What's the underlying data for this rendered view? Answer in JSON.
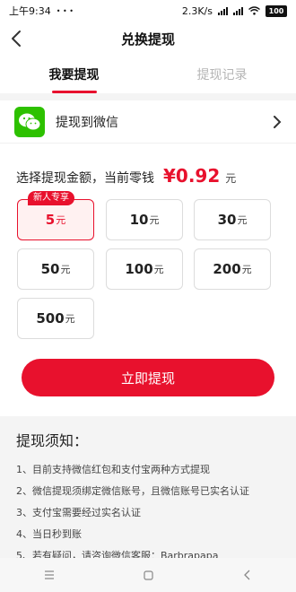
{
  "status": {
    "time": "上午9:34",
    "dots": "• • •",
    "net_speed": "2.3K/s",
    "battery": "100"
  },
  "header": {
    "title": "兑换提现"
  },
  "tabs": [
    {
      "label": "我要提现"
    },
    {
      "label": "提现记录"
    }
  ],
  "channel": {
    "label": "提现到微信"
  },
  "amount": {
    "prompt": "选择提现金额，当前零钱",
    "balance": "¥0.92",
    "unit": "元"
  },
  "badge": "新人专享",
  "options": [
    {
      "value": "5",
      "unit": "元",
      "selected": true
    },
    {
      "value": "10",
      "unit": "元",
      "selected": false
    },
    {
      "value": "30",
      "unit": "元",
      "selected": false
    },
    {
      "value": "50",
      "unit": "元",
      "selected": false
    },
    {
      "value": "100",
      "unit": "元",
      "selected": false
    },
    {
      "value": "200",
      "unit": "元",
      "selected": false
    },
    {
      "value": "500",
      "unit": "元",
      "selected": false
    }
  ],
  "button": {
    "label": "立即提现"
  },
  "notice": {
    "title": "提现须知：",
    "items": [
      "1、目前支持微信红包和支付宝两种方式提现",
      "2、微信提现须绑定微信账号，且微信账号已实名认证",
      "3、支付宝需要经过实名认证",
      "4、当日秒到账",
      "5、若有疑问，请咨询微信客服：Barbrapapa"
    ]
  },
  "colors": {
    "accent": "#e8112d",
    "wechat": "#2dc100"
  }
}
